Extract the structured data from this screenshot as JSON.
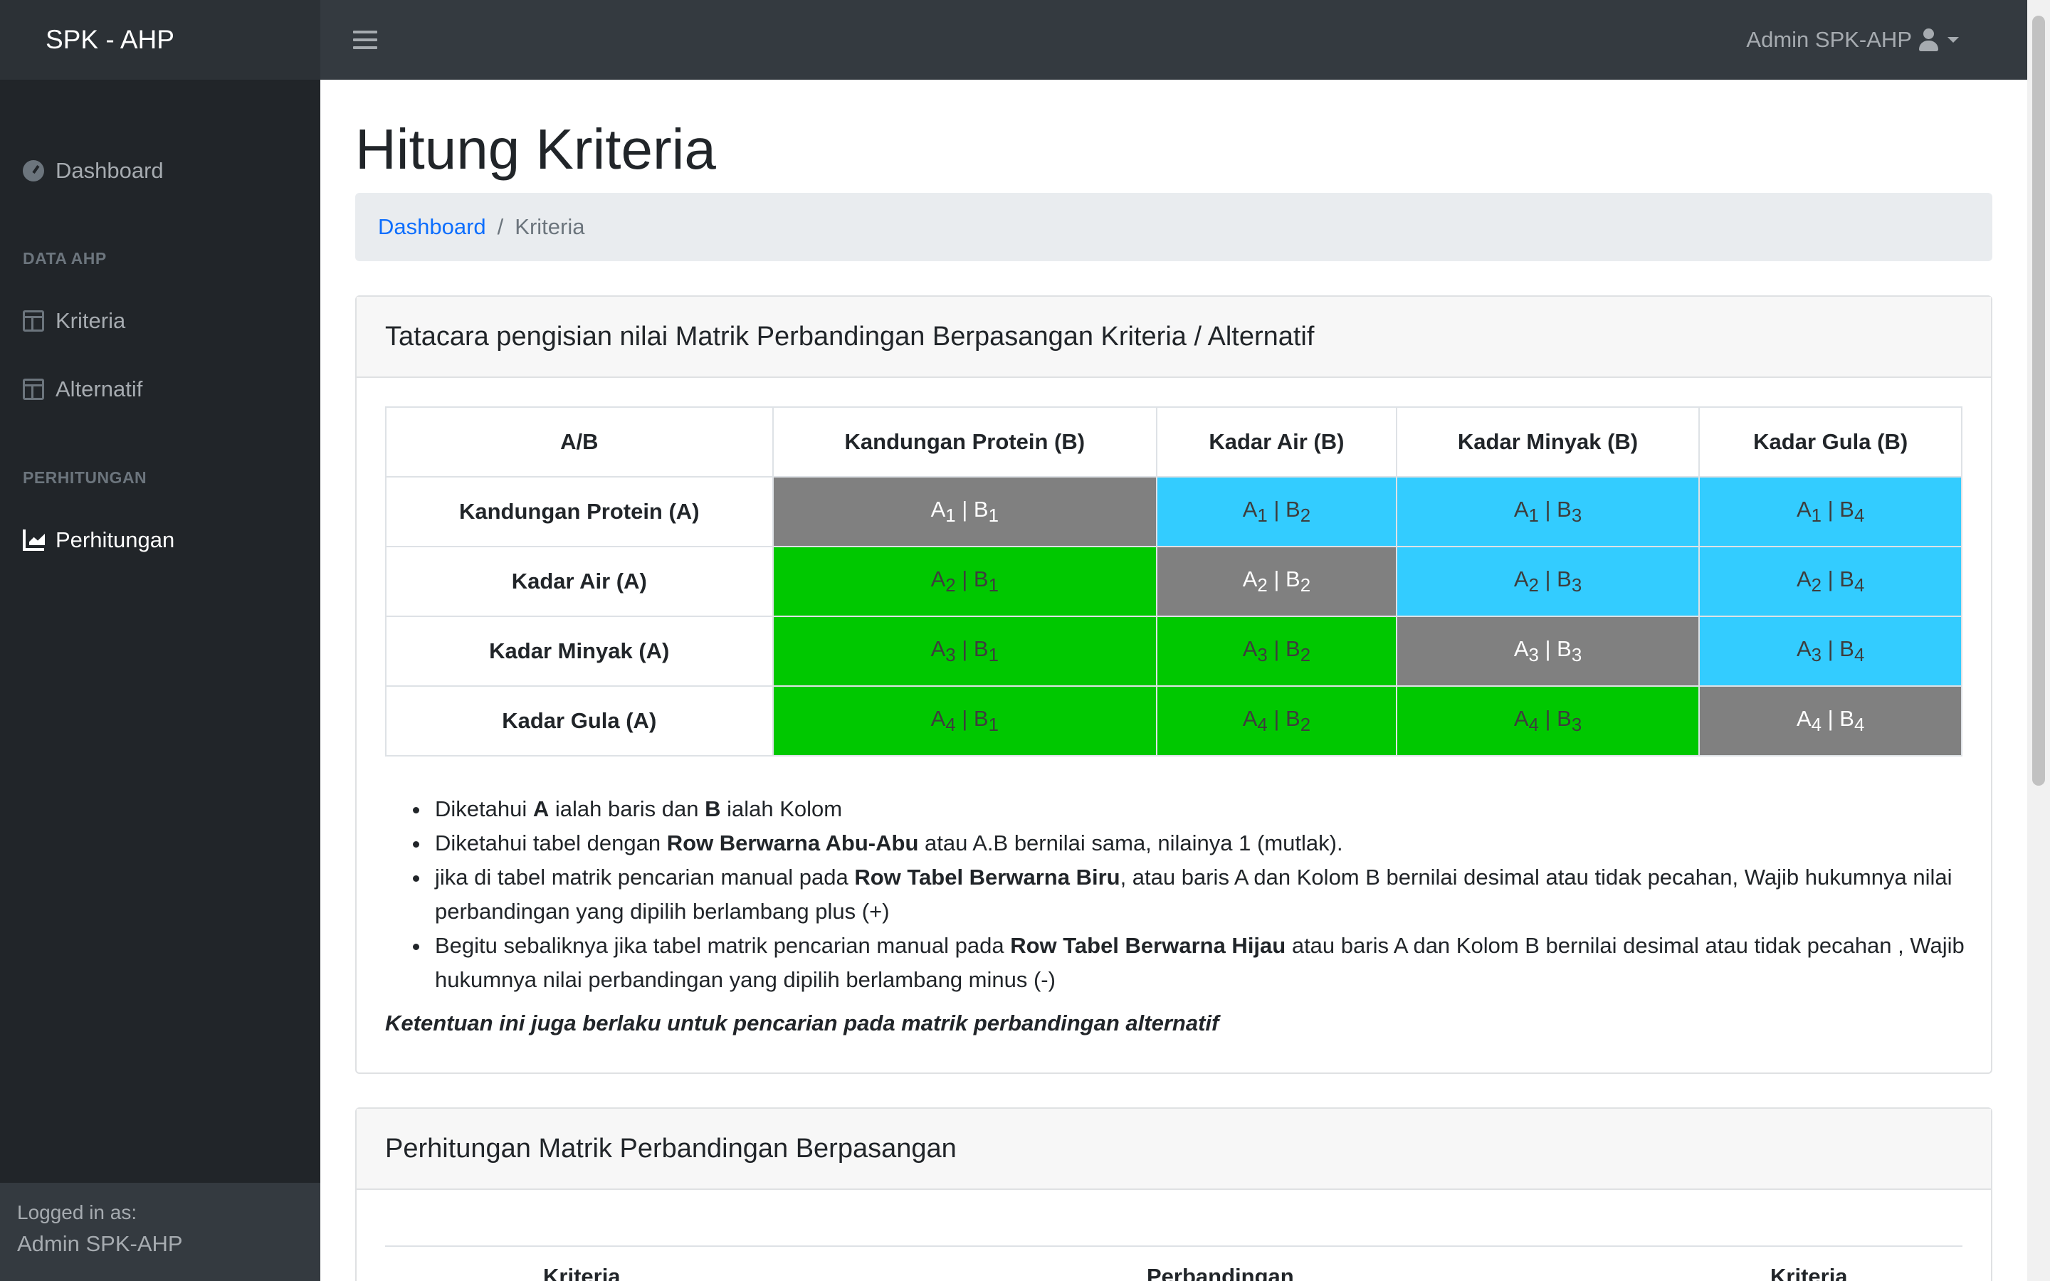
{
  "navbar": {
    "brand": "SPK - AHP",
    "toggle_icon": "hamburger-icon",
    "user_label": "Admin SPK-AHP",
    "user_icon": "user-icon"
  },
  "sidebar": {
    "items": [
      {
        "label": "Dashboard",
        "icon": "gauge-icon"
      },
      {
        "label": "Kriteria",
        "icon": "table-icon"
      },
      {
        "label": "Alternatif",
        "icon": "table-icon"
      },
      {
        "label": "Perhitungan",
        "icon": "chart-area-icon"
      }
    ],
    "headings": [
      "DATA AHP",
      "PERHITUNGAN"
    ],
    "footer": {
      "small": "Logged in as:",
      "name": "Admin SPK-AHP"
    }
  },
  "page": {
    "title": "Hitung Kriteria",
    "breadcrumb": {
      "link": "Dashboard",
      "separator": "/",
      "current": "Kriteria"
    }
  },
  "card1": {
    "header": "Tatacara pengisian nilai Matrik Perbandingan Berpasangan Kriteria / Alternatif",
    "table": {
      "corner": "A/B",
      "columns": [
        "Kandungan Protein (B)",
        "Kadar Air (B)",
        "Kadar Minyak (B)",
        "Kadar Gula (B)"
      ],
      "rows": [
        "Kandungan Protein (A)",
        "Kadar Air (A)",
        "Kadar Minyak (A)",
        "Kadar Gula (A)"
      ],
      "cell_colors": {
        "diagonal": "#808080",
        "upper": "#33ccff",
        "lower": "#00c800"
      }
    },
    "notes": {
      "n1": {
        "a": "Diketahui ",
        "b1": "A",
        "c": " ialah baris dan ",
        "b2": "B",
        "d": " ialah Kolom"
      },
      "n2": {
        "a": "Diketahui tabel dengan ",
        "b": "Row Berwarna Abu-Abu",
        "c": " atau A.B bernilai sama, nilainya 1 (mutlak)."
      },
      "n3": {
        "a": "jika di tabel matrik pencarian manual pada ",
        "b": "Row Tabel Berwarna Biru",
        "c": ", atau baris A dan Kolom B bernilai desimal atau tidak pecahan, Wajib hukumnya nilai perbandingan yang dipilih berlambang plus (+)"
      },
      "n4": {
        "a": "Begitu sebaliknya jika tabel matrik pencarian manual pada ",
        "b": "Row Tabel Berwarna Hijau",
        "c": " atau baris A dan Kolom B bernilai desimal atau tidak pecahan , Wajib hukumnya nilai perbandingan yang dipilih berlambang minus (-)"
      }
    },
    "footnote": "Ketentuan ini juga berlaku untuk pencarian pada matrik perbandingan alternatif"
  },
  "card2": {
    "header": "Perhitungan Matrik Perbandingan Berpasangan",
    "columns": [
      "Kriteria",
      "Perbandingan",
      "Kriteria"
    ]
  }
}
